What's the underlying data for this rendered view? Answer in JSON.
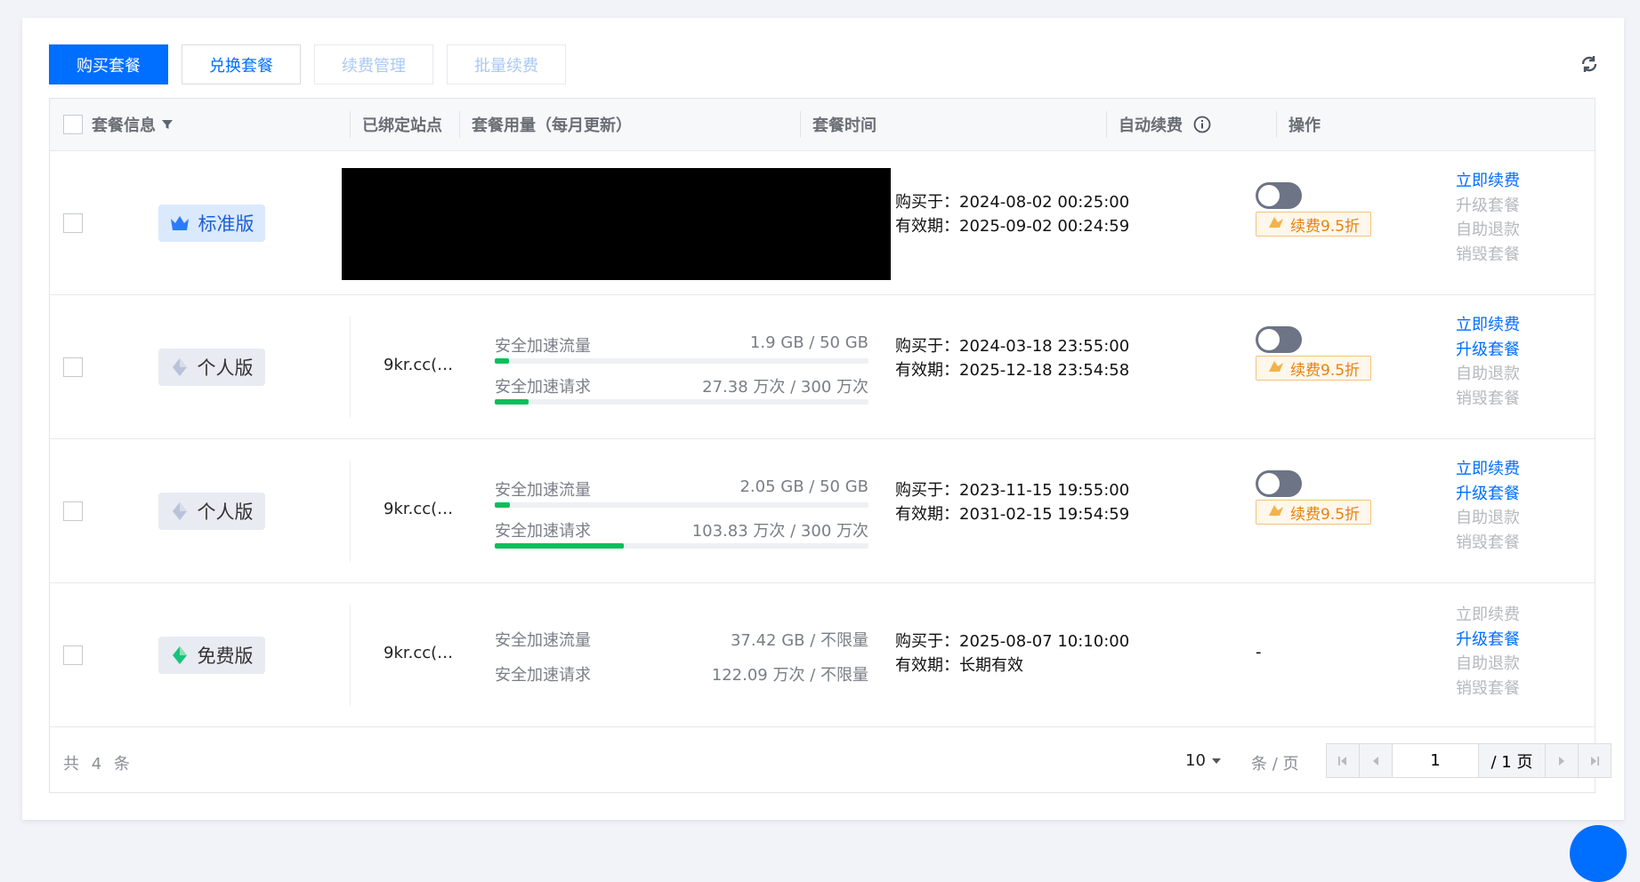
{
  "toolbar": {
    "buy": "购买套餐",
    "redeem": "兑换套餐",
    "renew_manage": "续费管理",
    "batch_renew": "批量续费"
  },
  "table": {
    "headers": {
      "plan_info": "套餐信息",
      "bound_site": "已绑定站点",
      "usage": "套餐用量（每月更新）",
      "time": "套餐时间",
      "auto_renew": "自动续费",
      "ops": "操作"
    },
    "rows": [
      {
        "plan": "标准版",
        "site": "",
        "usage": [],
        "bought": "购买于：2024-08-02 00:25:00",
        "valid": "有效期：2025-09-02 00:24:59",
        "auto_renew": "off",
        "discount": "续费9.5折",
        "ops": [
          {
            "label": "立即续费",
            "enabled": true
          },
          {
            "label": "升级套餐",
            "enabled": false
          },
          {
            "label": "自助退款",
            "enabled": false
          },
          {
            "label": "销毁套餐",
            "enabled": false
          }
        ]
      },
      {
        "plan": "个人版",
        "site": "9kr.cc(…",
        "usage": [
          {
            "label": "安全加速流量",
            "value": "1.9 GB / 50 GB",
            "fraction": 0.038
          },
          {
            "label": "安全加速请求",
            "value": "27.38 万次 / 300 万次",
            "fraction": 0.091
          }
        ],
        "bought": "购买于：2024-03-18 23:55:00",
        "valid": "有效期：2025-12-18 23:54:58",
        "auto_renew": "off",
        "discount": "续费9.5折",
        "ops": [
          {
            "label": "立即续费",
            "enabled": true
          },
          {
            "label": "升级套餐",
            "enabled": true
          },
          {
            "label": "自助退款",
            "enabled": false
          },
          {
            "label": "销毁套餐",
            "enabled": false
          }
        ]
      },
      {
        "plan": "个人版",
        "site": "9kr.cc(…",
        "usage": [
          {
            "label": "安全加速流量",
            "value": "2.05 GB / 50 GB",
            "fraction": 0.041
          },
          {
            "label": "安全加速请求",
            "value": "103.83 万次 / 300 万次",
            "fraction": 0.346
          }
        ],
        "bought": "购买于：2023-11-15 19:55:00",
        "valid": "有效期：2031-02-15 19:54:59",
        "auto_renew": "off",
        "discount": "续费9.5折",
        "ops": [
          {
            "label": "立即续费",
            "enabled": true
          },
          {
            "label": "升级套餐",
            "enabled": true
          },
          {
            "label": "自助退款",
            "enabled": false
          },
          {
            "label": "销毁套餐",
            "enabled": false
          }
        ]
      },
      {
        "plan": "免费版",
        "site": "9kr.cc(…",
        "usage": [
          {
            "label": "安全加速流量",
            "value": "37.42 GB / 不限量"
          },
          {
            "label": "安全加速请求",
            "value": "122.09 万次 / 不限量"
          }
        ],
        "bought": "购买于：2025-08-07 10:10:00",
        "valid": "有效期：长期有效",
        "auto_renew": "-",
        "discount": "",
        "ops": [
          {
            "label": "立即续费",
            "enabled": false
          },
          {
            "label": "升级套餐",
            "enabled": true
          },
          {
            "label": "自助退款",
            "enabled": false
          },
          {
            "label": "销毁套餐",
            "enabled": false
          }
        ]
      }
    ]
  },
  "footer": {
    "total": "共 4 条",
    "page_size": "10",
    "page_size_unit": "条 / 页",
    "current_page": "1",
    "total_pages": "/ 1 页"
  },
  "colors": {
    "primary": "#006eff",
    "progress": "#0abf5b",
    "discount": "#e5820e"
  },
  "icons": [
    "filter-icon",
    "info-icon",
    "refresh-icon",
    "crown-icon",
    "diamond-icon",
    "first-page-icon",
    "prev-page-icon",
    "next-page-icon",
    "last-page-icon"
  ]
}
